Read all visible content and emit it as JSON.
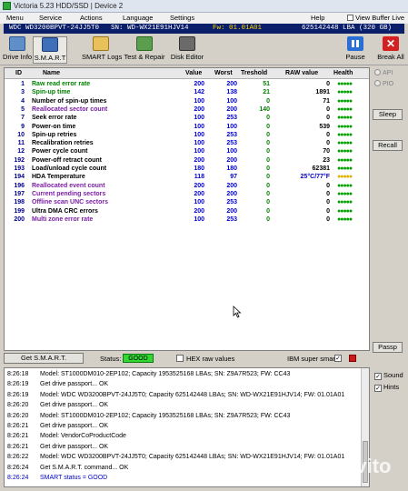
{
  "window": {
    "title": "Victoria 5.23 HDD/SSD | Device 2"
  },
  "menu": {
    "items": [
      "Menu",
      "Service",
      "Actions",
      "Language",
      "Settings",
      "Help"
    ],
    "view_buffer_live": "View Buffer Live"
  },
  "device": {
    "model": "WDC WD3200BPVT-24JJ5T0",
    "serial": "SN: WD-WX21E91HJV14",
    "firmware": "Fw: 01.01A01",
    "capacity": "625142448 LBA (320 GB)"
  },
  "toolbar": {
    "buttons": [
      "Drive Info",
      "S.M.A.R.T",
      "SMART Logs",
      "Test & Repair",
      "Disk Editor"
    ],
    "pause": "Pause",
    "break_all": "Break All"
  },
  "smart": {
    "columns": [
      "ID",
      "Name",
      "Value",
      "Worst",
      "Treshold",
      "RAW value",
      "Health"
    ],
    "rows": [
      {
        "id": "1",
        "name": "Raw read error rate",
        "value": "200",
        "worst": "200",
        "tresh": "51",
        "raw": "0",
        "health": "●●●●●",
        "color": "#008000"
      },
      {
        "id": "3",
        "name": "Spin-up time",
        "value": "142",
        "worst": "138",
        "tresh": "21",
        "raw": "1891",
        "health": "●●●●●",
        "color": "#008000"
      },
      {
        "id": "4",
        "name": "Number of spin-up times",
        "value": "100",
        "worst": "100",
        "tresh": "0",
        "raw": "71",
        "health": "●●●●●",
        "color": "#000000"
      },
      {
        "id": "5",
        "name": "Reallocated sector count",
        "value": "200",
        "worst": "200",
        "tresh": "140",
        "raw": "0",
        "health": "●●●●●",
        "color": "#7b1fa2"
      },
      {
        "id": "7",
        "name": "Seek error rate",
        "value": "100",
        "worst": "253",
        "tresh": "0",
        "raw": "0",
        "health": "●●●●●",
        "color": "#000000"
      },
      {
        "id": "9",
        "name": "Power-on time",
        "value": "100",
        "worst": "100",
        "tresh": "0",
        "raw": "539",
        "health": "●●●●●",
        "color": "#000000"
      },
      {
        "id": "10",
        "name": "Spin-up retries",
        "value": "100",
        "worst": "253",
        "tresh": "0",
        "raw": "0",
        "health": "●●●●●",
        "color": "#000000"
      },
      {
        "id": "11",
        "name": "Recalibration retries",
        "value": "100",
        "worst": "253",
        "tresh": "0",
        "raw": "0",
        "health": "●●●●●",
        "color": "#000000"
      },
      {
        "id": "12",
        "name": "Power cycle count",
        "value": "100",
        "worst": "100",
        "tresh": "0",
        "raw": "70",
        "health": "●●●●●",
        "color": "#000000"
      },
      {
        "id": "192",
        "name": "Power-off retract count",
        "value": "200",
        "worst": "200",
        "tresh": "0",
        "raw": "23",
        "health": "●●●●●",
        "color": "#000000"
      },
      {
        "id": "193",
        "name": "Load/unload cycle count",
        "value": "180",
        "worst": "180",
        "tresh": "0",
        "raw": "62381",
        "health": "●●●●●",
        "color": "#000000"
      },
      {
        "id": "194",
        "name": "HDA Temperature",
        "value": "118",
        "worst": "97",
        "tresh": "0",
        "raw": "25°C/77°F",
        "health": "●●●●●",
        "color": "#000000"
      },
      {
        "id": "196",
        "name": "Reallocated event count",
        "value": "200",
        "worst": "200",
        "tresh": "0",
        "raw": "0",
        "health": "●●●●●",
        "color": "#7b1fa2"
      },
      {
        "id": "197",
        "name": "Current pending sectors",
        "value": "200",
        "worst": "200",
        "tresh": "0",
        "raw": "0",
        "health": "●●●●●",
        "color": "#7b1fa2"
      },
      {
        "id": "198",
        "name": "Offline scan UNC sectors",
        "value": "100",
        "worst": "253",
        "tresh": "0",
        "raw": "0",
        "health": "●●●●●",
        "color": "#7b1fa2"
      },
      {
        "id": "199",
        "name": "Ultra DMA CRC errors",
        "value": "200",
        "worst": "200",
        "tresh": "0",
        "raw": "0",
        "health": "●●●●●",
        "color": "#000000"
      },
      {
        "id": "200",
        "name": "Multi zone error rate",
        "value": "100",
        "worst": "253",
        "tresh": "0",
        "raw": "0",
        "health": "●●●●●",
        "color": "#7b1fa2"
      }
    ]
  },
  "bottom": {
    "get_smart": "Get S.M.A.R.T.",
    "status_label": "Status:",
    "status_value": "GOOD",
    "hex_label": "HEX raw values",
    "ibm_label": "IBM super smart:",
    "ibm_check": "✓"
  },
  "side": {
    "api": "API",
    "pio": "PIO",
    "sleep": "Sleep",
    "recall": "Recall",
    "passp": "Passp"
  },
  "log": {
    "lines": [
      {
        "time": "8:26:18",
        "text": "Model: ST1000DM010-2EP102; Capacity 1953525168 LBAs; SN: Z9A7R523; FW: CC43",
        "blue": false
      },
      {
        "time": "8:26:19",
        "text": "Get drive passport... OK",
        "blue": false
      },
      {
        "time": "8:26:19",
        "text": "Model: WDC WD3200BPVT-24JJ5T0; Capacity 625142448 LBAs; SN: WD-WX21E91HJV14; FW: 01.01A01",
        "blue": false
      },
      {
        "time": "8:26:20",
        "text": "Get drive passport... OK",
        "blue": false
      },
      {
        "time": "8:26:20",
        "text": "Model: ST1000DM010-2EP102; Capacity 1953525168 LBAs; SN: Z9A7R523; FW: CC43",
        "blue": false
      },
      {
        "time": "8:26:21",
        "text": "Get drive passport... OK",
        "blue": false
      },
      {
        "time": "8:26:21",
        "text": "Model: VendorCoProductCode",
        "blue": false
      },
      {
        "time": "8:26:21",
        "text": "Get drive passport... OK",
        "blue": false
      },
      {
        "time": "8:26:22",
        "text": "Model: WDC WD3200BPVT-24JJ5T0; Capacity 625142448 LBAs; SN: WD-WX21E91HJV14; FW: 01.01A01",
        "blue": false
      },
      {
        "time": "8:26:24",
        "text": "Get S.M.A.R.T. command... OK",
        "blue": false
      },
      {
        "time": "8:26:24",
        "text": "SMART status = GOOD",
        "blue": true
      }
    ],
    "sound": "Sound",
    "hints": "Hints"
  },
  "watermark": "Avito"
}
